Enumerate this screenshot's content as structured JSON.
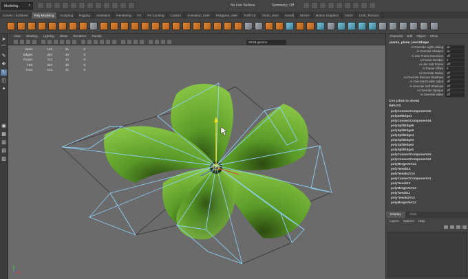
{
  "topbar": {
    "mode": "Modeling",
    "live_surface": "No Live Surface",
    "symmetry": "Symmetry: Off"
  },
  "shelf_tabs": [
    "Curves / Surfaces",
    "Poly Modeling",
    "Sculpting",
    "Rigging",
    "Animation",
    "Rendering",
    "FX",
    "FX Caching",
    "Custom",
    "Animation_User",
    "Polygons_User",
    "TURTLE",
    "XGen_User",
    "Arnold",
    "MASH",
    "Motion Graphics",
    "XGen",
    "CGE_Terrain2"
  ],
  "active_shelf_tab": "Poly Modeling",
  "panel_menu": [
    "View",
    "Shading",
    "Lighting",
    "Show",
    "Renderer",
    "Panels"
  ],
  "viewport": {
    "color_space": "sRGB gamma",
    "hud": [
      {
        "label": "Verts:",
        "a": "142",
        "b": "21",
        "c": "0"
      },
      {
        "label": "Edges:",
        "a": "254",
        "b": "34",
        "c": "0"
      },
      {
        "label": "Faces:",
        "a": "114",
        "b": "14",
        "c": "0"
      },
      {
        "label": "Tris:",
        "a": "220",
        "b": "25",
        "c": "0"
      },
      {
        "label": "UVs:",
        "a": "142",
        "b": "21",
        "c": "0"
      }
    ]
  },
  "channel_box": {
    "menu": [
      "Channels",
      "Edit",
      "Object",
      "Show"
    ],
    "object_name": "plants_plane_low1Shape",
    "attributes": [
      {
        "name": "Ai Override Light Linking",
        "value": "on"
      },
      {
        "name": "Ai Override Shaders",
        "value": "on"
      },
      {
        "name": "Ai Use Frame Extension",
        "value": "off"
      },
      {
        "name": "Ai Frame Number",
        "value": "0"
      },
      {
        "name": "Ai Use Sub Frame",
        "value": "off"
      },
      {
        "name": "Ai Frame Offset",
        "value": "0"
      },
      {
        "name": "Ai Override Nodes",
        "value": "off"
      },
      {
        "name": "Ai Override Receive Shadows",
        "value": "off"
      },
      {
        "name": "Ai Override Double Sided",
        "value": "off"
      },
      {
        "name": "Ai Override Self Shadows",
        "value": "off"
      },
      {
        "name": "Ai Override Opaque",
        "value": "off"
      },
      {
        "name": "Ai Override Matte",
        "value": "off"
      }
    ],
    "cvs_label": "CVs (click to show)",
    "inputs_label": "INPUTS",
    "inputs": [
      "polyConnectComponents5",
      "polyDelEdge1",
      "polyConnectComponents4",
      "polySplitEdge6",
      "polySplitEdge5",
      "polySplitEdge4",
      "polySplitEdge3",
      "polySplitEdge2",
      "polySplitEdge1",
      "polyConnectComponents3",
      "polyConnectComponents2",
      "polyMergeVert14",
      "polyTweak14",
      "polyTweakUV14",
      "polyConnectComponents1",
      "polyTweak13",
      "polyMergeVert13",
      "polyTweak11",
      "polyTweakUV13",
      "polyMergeVert12"
    ]
  },
  "layer_editor": {
    "tabs": [
      "Display",
      "Anim"
    ],
    "active_tab": "Display",
    "menu": [
      "Layers",
      "Options",
      "Help"
    ]
  },
  "colors": {
    "ui_bg": "#444444",
    "viewport_bg": "#6b6b6b",
    "selection_blue": "#7ec8f0",
    "leaf_green": "#5f9e2a",
    "shelf_active": "#5d5d5d",
    "manip_yellow": "#f0e020"
  }
}
